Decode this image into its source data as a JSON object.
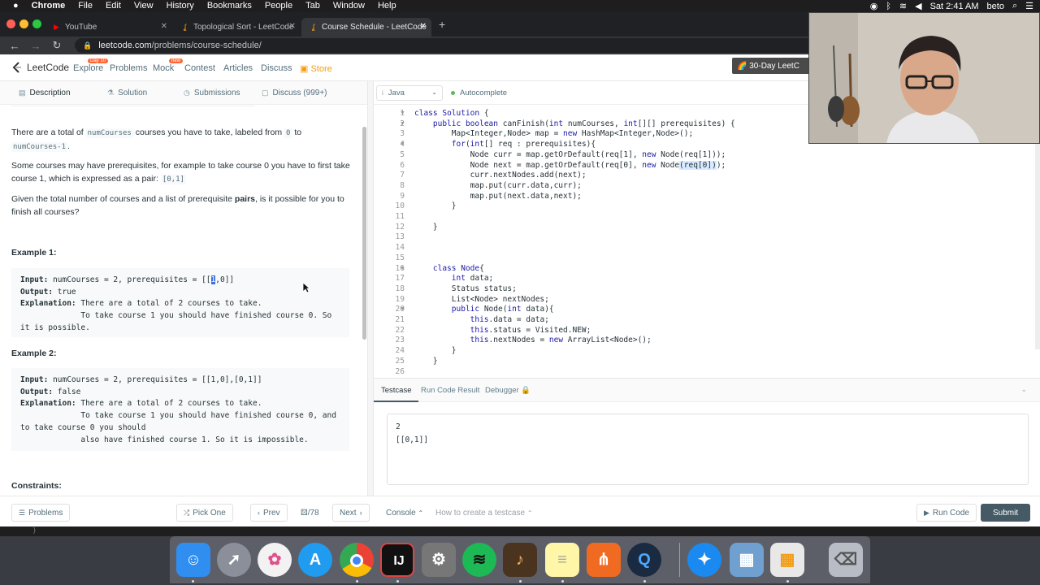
{
  "menubar": {
    "apple": "",
    "items": [
      "Chrome",
      "File",
      "Edit",
      "View",
      "History",
      "Bookmarks",
      "People",
      "Tab",
      "Window",
      "Help"
    ],
    "clock": "Sat 2:41 AM",
    "user": "beto"
  },
  "browser": {
    "tabs": [
      {
        "title": "YouTube",
        "favicon": "youtube-icon",
        "color": "#ff0000"
      },
      {
        "title": "Topological Sort - LeetCode",
        "favicon": "leetcode-icon",
        "color": "#f89f1b"
      },
      {
        "title": "Course Schedule - LeetCode",
        "favicon": "leetcode-icon",
        "color": "#f89f1b"
      }
    ],
    "url_host": "leetcode.com",
    "url_path": "/problems/course-schedule/"
  },
  "header": {
    "logo": "LeetCode",
    "nav": [
      {
        "label": "Explore",
        "badge": "Day 10"
      },
      {
        "label": "Problems",
        "badge": ""
      },
      {
        "label": "Mock",
        "badge": "new"
      },
      {
        "label": "Contest",
        "badge": ""
      },
      {
        "label": "Articles",
        "badge": ""
      },
      {
        "label": "Discuss",
        "badge": ""
      }
    ],
    "store": "Store",
    "promo": "30-Day LeetC"
  },
  "left_tabs": [
    "Description",
    "Solution",
    "Submissions",
    "Discuss (999+)"
  ],
  "description": {
    "p1_a": "There are a total of ",
    "p1_code1": "numCourses",
    "p1_b": " courses you have to take, labeled from ",
    "p1_code2": "0",
    "p1_c": " to ",
    "p1_code3": "numCourses-1",
    "p1_d": ".",
    "p2_a": "Some courses may have prerequisites, for example to take course 0 you have to first take course 1, which is expressed as a pair: ",
    "p2_code": "[0,1]",
    "p3_a": "Given the total number of courses and a list of prerequisite ",
    "p3_bold": "pairs",
    "p3_b": ", is it possible for you to finish all courses?",
    "example1_title": "Example 1:",
    "example1": {
      "input_label": "Input:",
      "input_a": " numCourses = 2, prerequisites = [[",
      "input_sel": "1",
      "input_b": ",0]]",
      "output_label": "Output:",
      "output": " true",
      "expl_label": "Explanation:",
      "expl_1": " There are a total of 2 courses to take.",
      "expl_2": "             To take course 1 you should have finished course 0. So",
      "expl_3": "it is possible."
    },
    "example2_title": "Example 2:",
    "example2": {
      "input_label": "Input:",
      "input": " numCourses = 2, prerequisites = [[1,0],[0,1]]",
      "output_label": "Output:",
      "output": " false",
      "expl_label": "Explanation:",
      "expl_1": " There are a total of 2 courses to take.",
      "expl_2": "             To take course 1 you should have finished course 0, and",
      "expl_3": "to take course 0 you should",
      "expl_4": "             also have finished course 1. So it is impossible."
    },
    "constraints_title": "Constraints:"
  },
  "editor": {
    "language": "Java",
    "autocomplete": "Autocomplete",
    "line_numbers": [
      "1",
      "2",
      "3",
      "4",
      "5",
      "6",
      "7",
      "8",
      "9",
      "10",
      "11",
      "12",
      "13",
      "14",
      "15",
      "16",
      "17",
      "18",
      "19",
      "20",
      "21",
      "22",
      "23",
      "24",
      "25",
      "26"
    ],
    "lines": [
      "class Solution {",
      "    public boolean canFinish(int numCourses, int[][] prerequisites) {",
      "        Map<Integer,Node> map = new HashMap<Integer,Node>();",
      "        for(int[] req : prerequisites){",
      "            Node curr = map.getOrDefault(req[1], new Node(req[1]));",
      "            Node next = map.getOrDefault(req[0], new Node(req[0]));",
      "            curr.nextNodes.add(next);",
      "            map.put(curr.data,curr);",
      "            map.put(next.data,next);",
      "        }",
      "",
      "    }",
      "",
      "",
      "",
      "    class Node{",
      "        int data;",
      "        Status status;",
      "        List<Node> nextNodes;",
      "        public Node(int data){",
      "            this.data = data;",
      "            this.status = Visited.NEW;",
      "            this.nextNodes = new ArrayList<Node>();",
      "        }",
      "    }",
      ""
    ]
  },
  "console": {
    "tabs": [
      "Testcase",
      "Run Code Result",
      "Debugger"
    ],
    "testcase_input": "2\n[[0,1]]"
  },
  "footer": {
    "problems": "Problems",
    "pick_one": "Pick One",
    "prev": "Prev",
    "page": "/78",
    "next": "Next",
    "console": "Console",
    "howto": "How to create a testcase",
    "run": "Run Code",
    "submit": "Submit"
  },
  "below_text": "}",
  "dock": [
    "finder-icon",
    "launchpad-icon",
    "photos-icon",
    "app-store-icon",
    "chrome-icon",
    "intellij-icon",
    "system-preferences-icon",
    "spotify-icon",
    "garageband-icon",
    "notes-icon",
    "sourcetree-icon",
    "quicktime-icon",
    "safari-icon",
    "preview-icon",
    "calculator-icon",
    "trash-icon"
  ]
}
